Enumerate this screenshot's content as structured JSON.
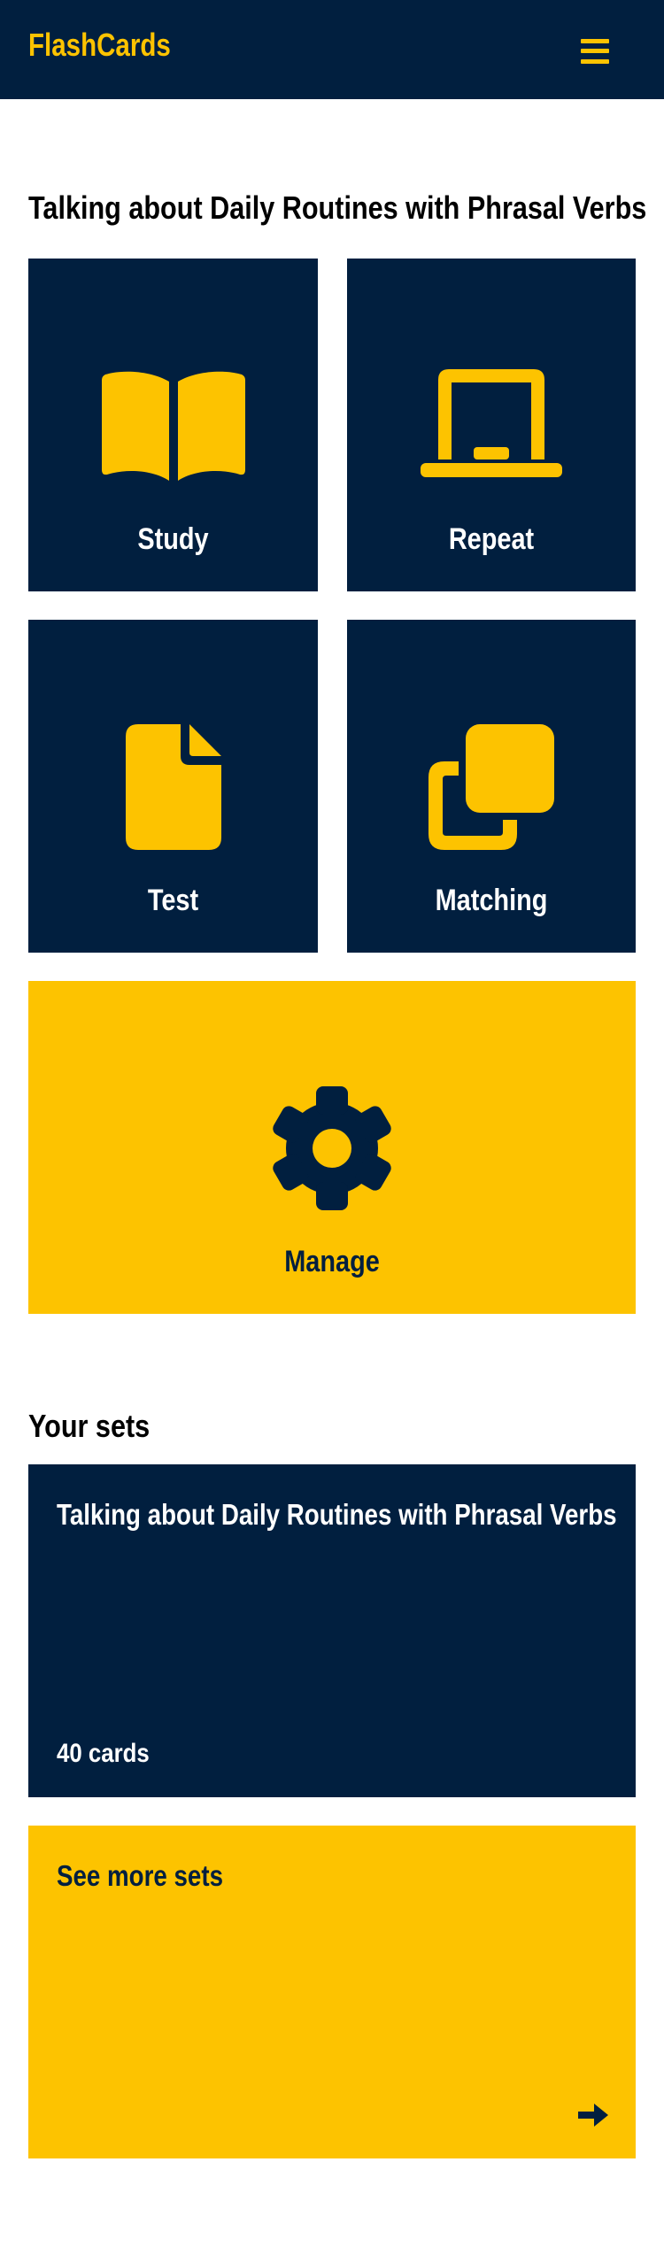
{
  "header": {
    "brand": "FlashCards",
    "menu_icon": "hamburger-menu-icon"
  },
  "colors": {
    "navy": "#011f3f",
    "yellow": "#fdc300",
    "white": "#ffffff"
  },
  "deck": {
    "title": "Talking about Daily Routines with Phrasal Verbs",
    "modes": [
      {
        "label": "Study",
        "icon": "open-book-icon"
      },
      {
        "label": "Repeat",
        "icon": "laptop-icon"
      },
      {
        "label": "Test",
        "icon": "document-icon"
      },
      {
        "label": "Matching",
        "icon": "clone-icon"
      },
      {
        "label": "Manage",
        "icon": "gear-icon"
      }
    ]
  },
  "sets": {
    "title": "Your sets",
    "items": [
      {
        "title": "Talking about Daily Routines with Phrasal Verbs",
        "count": "40 cards"
      }
    ],
    "more": {
      "label": "See more sets",
      "icon": "arrow-right-icon"
    }
  }
}
